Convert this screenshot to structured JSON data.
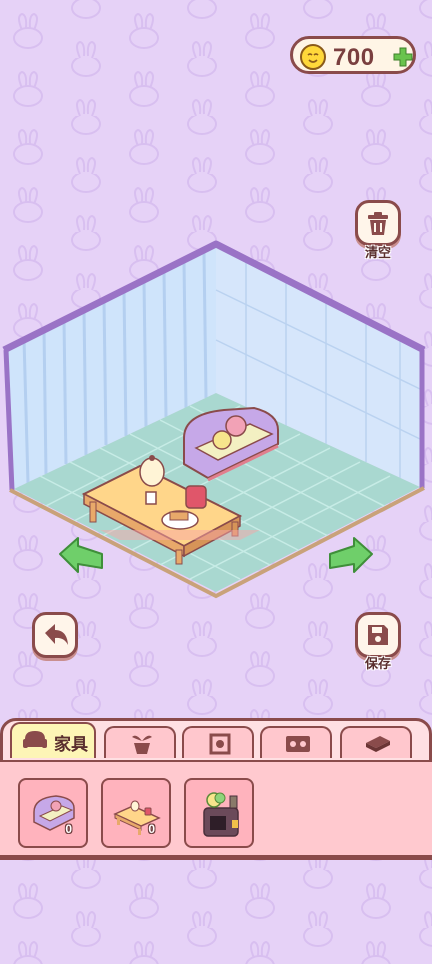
{
  "header": {
    "coins": "700",
    "coin_icon": "coin-face-icon",
    "add_icon": "plus-icon"
  },
  "actions": {
    "clear_label": "清空",
    "save_label": "保存"
  },
  "tabs": [
    {
      "label": "家具",
      "icon": "sofa-icon",
      "active": true
    },
    {
      "label": "",
      "icon": "plant-pot-icon",
      "active": false
    },
    {
      "label": "",
      "icon": "wall-frame-icon",
      "active": false
    },
    {
      "label": "",
      "icon": "rug-icon",
      "active": false
    },
    {
      "label": "",
      "icon": "book-icon",
      "active": false
    }
  ],
  "items": [
    {
      "icon": "sofa-item-icon",
      "count": "0"
    },
    {
      "icon": "tea-table-item-icon",
      "count": "0"
    },
    {
      "icon": "fireplace-item-icon",
      "count": ""
    }
  ],
  "colors": {
    "background": "#e6d2f7",
    "outline": "#8a4b4b",
    "panel": "#ffc9cf",
    "active_tab": "#fdf5b6",
    "arrow_green": "#6fcf6a"
  }
}
